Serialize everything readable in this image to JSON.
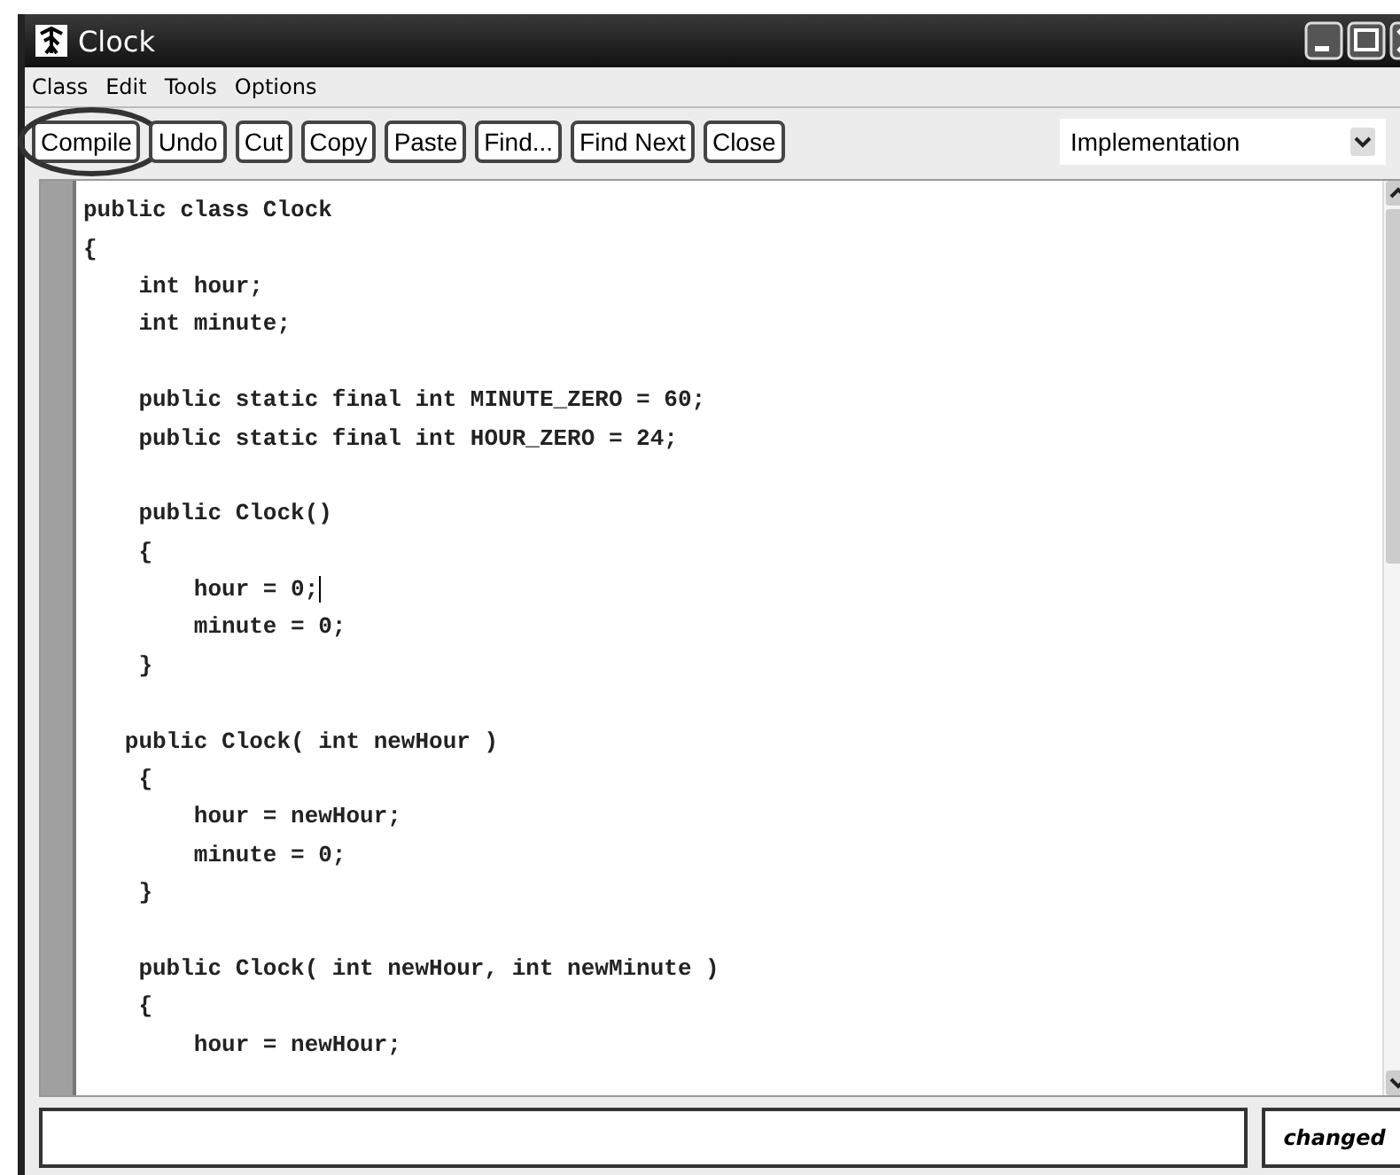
{
  "window": {
    "title": "Clock"
  },
  "menu": [
    "Class",
    "Edit",
    "Tools",
    "Options"
  ],
  "toolbar": [
    {
      "label": "Compile",
      "circled": true
    },
    {
      "label": "Undo",
      "circled": false
    },
    {
      "label": "Cut",
      "circled": false
    },
    {
      "label": "Copy",
      "circled": false
    },
    {
      "label": "Paste",
      "circled": false
    },
    {
      "label": "Find...",
      "circled": false
    },
    {
      "label": "Find Next",
      "circled": false
    },
    {
      "label": "Close",
      "circled": false
    }
  ],
  "view_selector": {
    "value": "Implementation"
  },
  "code_lines": [
    {
      "text": "public class Clock",
      "cursor": false
    },
    {
      "text": "{",
      "cursor": false
    },
    {
      "text": "    int hour;",
      "cursor": false
    },
    {
      "text": "    int minute;",
      "cursor": false
    },
    {
      "cursor": false
    },
    {
      "text": "    public static final int MINUTE_ZERO = 60;",
      "cursor": false
    },
    {
      "text": "    public static final int HOUR_ZERO = 24;",
      "cursor": false
    },
    {
      "cursor": false
    },
    {
      "text": "    public Clock()",
      "cursor": false
    },
    {
      "text": "    {",
      "cursor": false
    },
    {
      "text": "        hour = 0;",
      "cursor": true
    },
    {
      "text": "        minute = 0;",
      "cursor": false
    },
    {
      "text": "    }",
      "cursor": false
    },
    {
      "cursor": false
    },
    {
      "text": "   public Clock( int newHour )",
      "cursor": false
    },
    {
      "text": "    {",
      "cursor": false
    },
    {
      "text": "        hour = newHour;",
      "cursor": false
    },
    {
      "text": "        minute = 0;",
      "cursor": false
    },
    {
      "text": "    }",
      "cursor": false
    },
    {
      "cursor": false
    },
    {
      "text": "    public Clock( int newHour, int newMinute )",
      "cursor": false
    },
    {
      "text": "    {",
      "cursor": false
    },
    {
      "text": "        hour = newHour;",
      "cursor": false
    }
  ],
  "status_bar": {
    "state": "changed"
  }
}
